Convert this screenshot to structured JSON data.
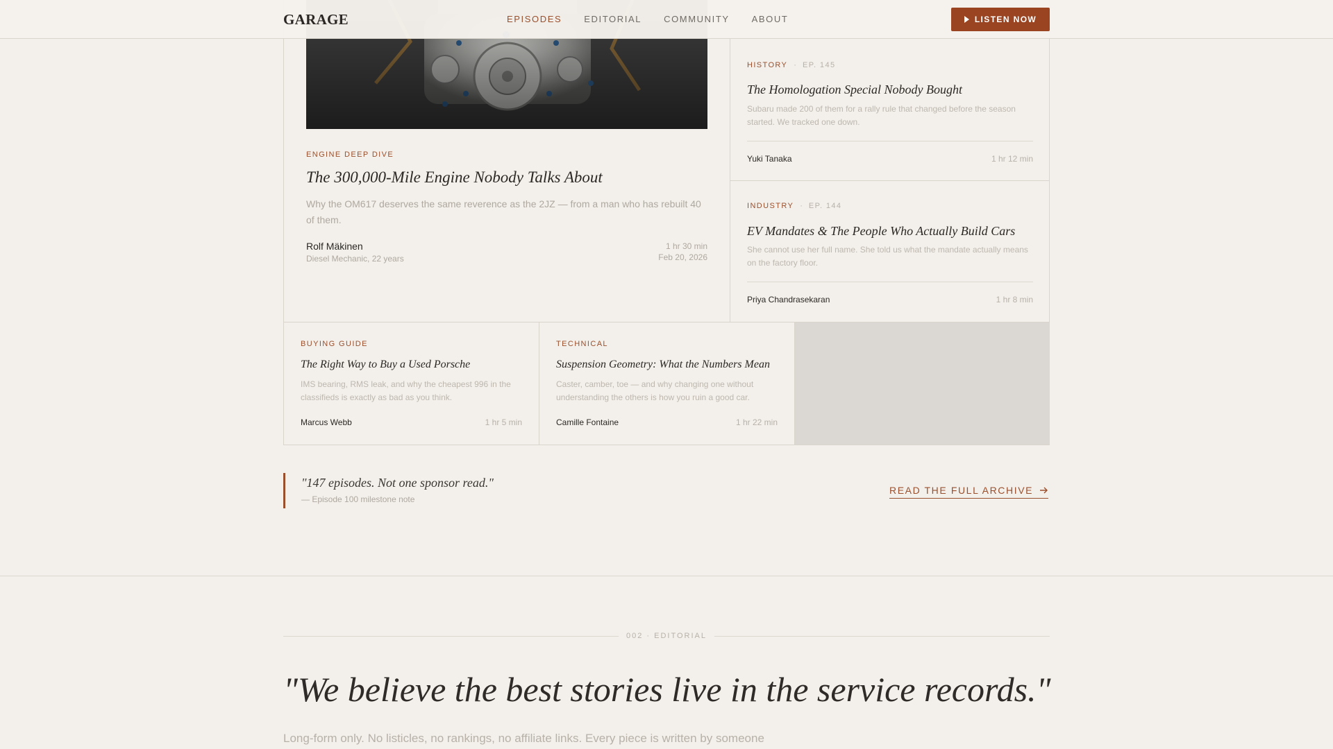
{
  "header": {
    "logo": "GARAGE",
    "nav": [
      {
        "label": "EPISODES",
        "active": true
      },
      {
        "label": "EDITORIAL",
        "active": false
      },
      {
        "label": "COMMUNITY",
        "active": false
      },
      {
        "label": "ABOUT",
        "active": false
      }
    ],
    "cta_label": "LISTEN NOW"
  },
  "feature": {
    "image_icon": "engine-photo",
    "category": "ENGINE DEEP DIVE",
    "title": "The 300,000-Mile Engine Nobody Talks About",
    "description": "Why the OM617 deserves the same reverence as the 2JZ — from a man who has rebuilt 40 of them.",
    "author": "Rolf Mäkinen",
    "author_role": "Diesel Mechanic, 22 years",
    "duration": "1 hr 30 min",
    "date": "Feb 20, 2026"
  },
  "side_cards": [
    {
      "category": "HISTORY",
      "separator": "·",
      "episode": "EP. 145",
      "title": "The Homologation Special Nobody Bought",
      "description": "Subaru made 200 of them for a rally rule that changed before the season started. We tracked one down.",
      "author": "Yuki Tanaka",
      "duration": "1 hr 12 min"
    },
    {
      "category": "INDUSTRY",
      "separator": "·",
      "episode": "EP. 144",
      "title": "EV Mandates & The People Who Actually Build Cars",
      "description": "She cannot use her full name. She told us what the mandate actually means on the factory floor.",
      "author": "Priya Chandrasekaran",
      "duration": "1 hr 8 min"
    }
  ],
  "small_cards": [
    {
      "category": "BUYING GUIDE",
      "title": "The Right Way to Buy a Used Porsche",
      "description": "IMS bearing, RMS leak, and why the cheapest 996 in the classifieds is exactly as bad as you think.",
      "author": "Marcus Webb",
      "duration": "1 hr 5 min"
    },
    {
      "category": "TECHNICAL",
      "title": "Suspension Geometry: What the Numbers Mean",
      "description": "Caster, camber, toe — and why changing one without understanding the others is how you ruin a good car.",
      "author": "Camille Fontaine",
      "duration": "1 hr 22 min"
    }
  ],
  "quote": {
    "text": "\"147 episodes. Not one sponsor read.\"",
    "cite": "— Episode 100 milestone note"
  },
  "archive_link": {
    "label": "READ THE FULL ARCHIVE",
    "icon": "arrow-right-icon"
  },
  "editorial": {
    "label": "002 · EDITORIAL",
    "quote": "\"We believe the best stories live in the service records.\"",
    "body": "Long-form only. No listicles, no rankings, no affiliate links. Every piece is written by someone"
  },
  "colors": {
    "accent": "#9a4f2c",
    "button": "#9a4422",
    "background": "#f3f0eb"
  }
}
